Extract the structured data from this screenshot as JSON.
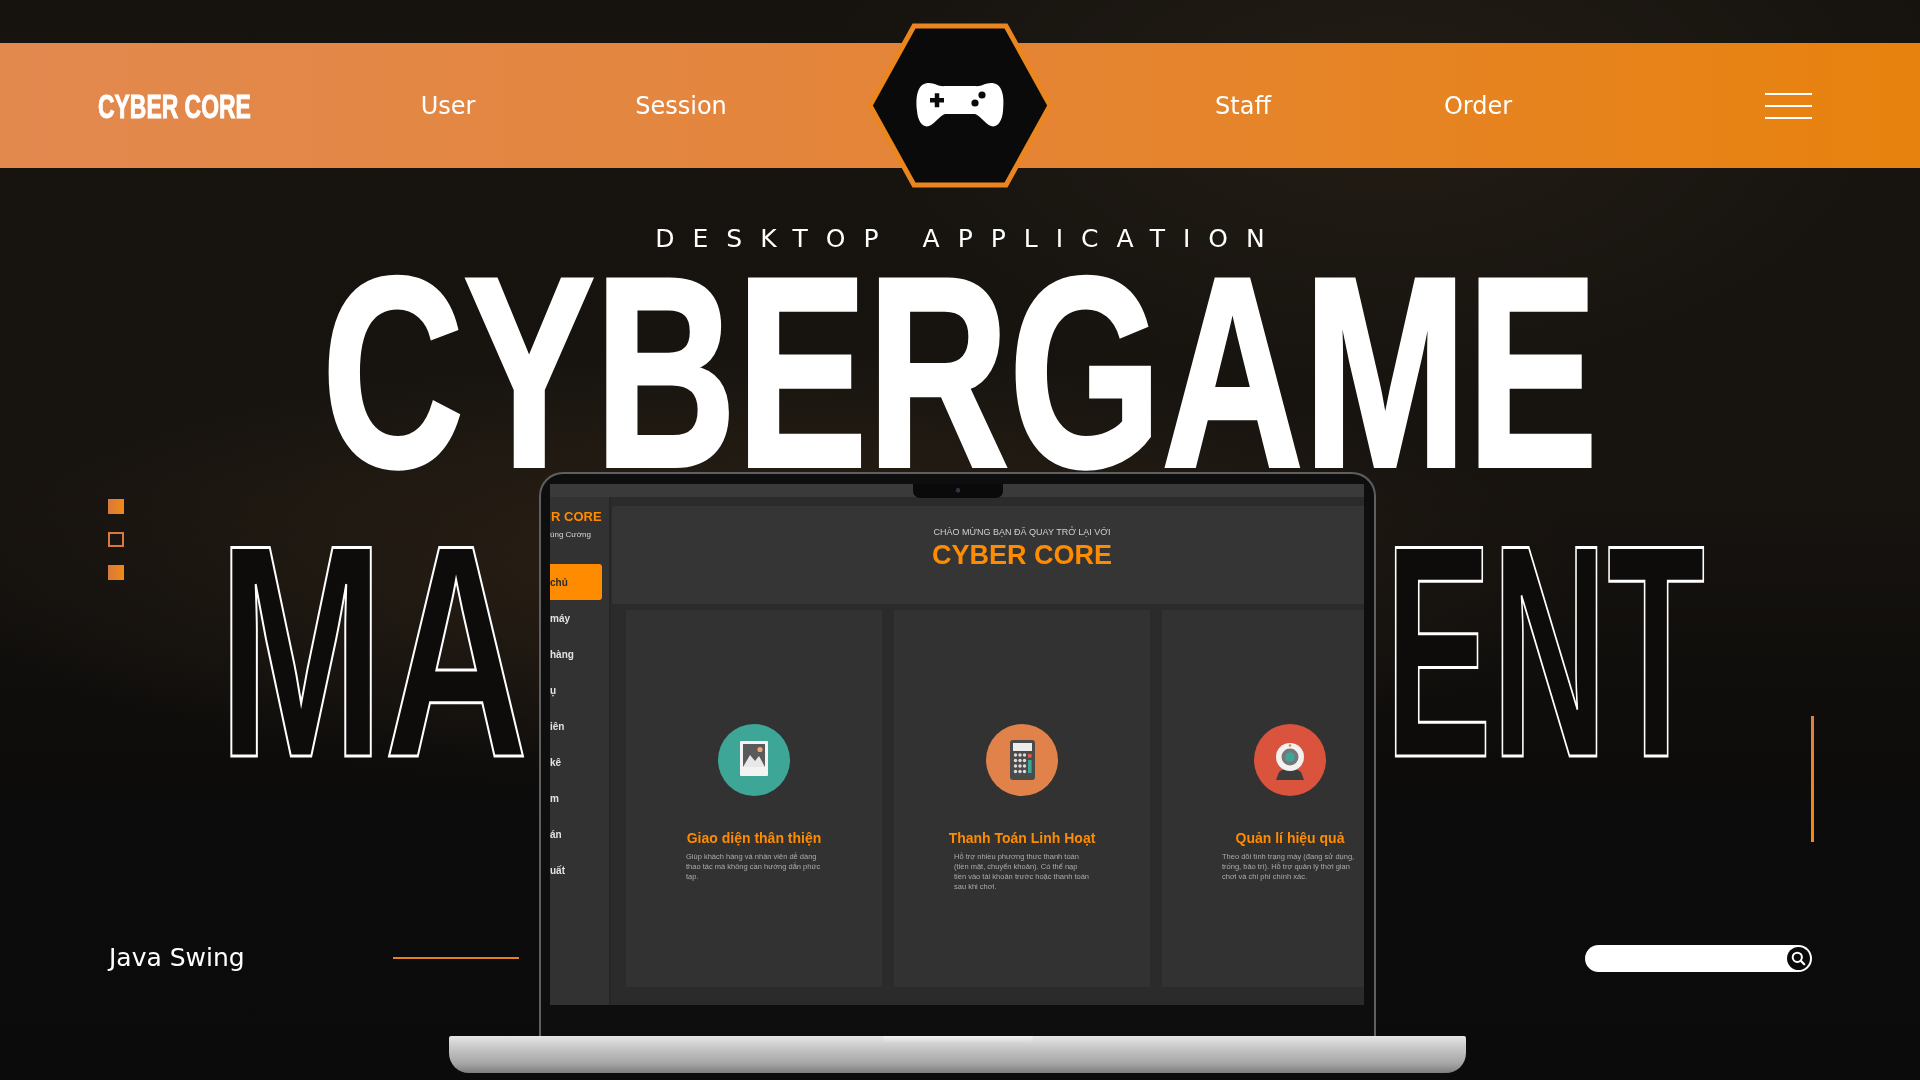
{
  "header": {
    "logo": "CYBER CORE",
    "nav": [
      {
        "label": "User"
      },
      {
        "label": "Session"
      },
      {
        "label": "Staff"
      },
      {
        "label": "Order"
      }
    ]
  },
  "hero": {
    "subtitle": "DESKTOP APPLICATION",
    "title": "CYBERGAME",
    "outline_left": "MA",
    "outline_right": "ENT"
  },
  "side_markers": [
    {
      "filled": true
    },
    {
      "filled": false
    },
    {
      "filled": true
    }
  ],
  "laptop_app": {
    "sidebar": {
      "brand": "R CORE",
      "user": "ùng Cường",
      "menu": [
        {
          "label": "chủ",
          "selected": true
        },
        {
          "label": "máy",
          "selected": false
        },
        {
          "label": "hàng",
          "selected": false
        },
        {
          "label": "ụ",
          "selected": false
        },
        {
          "label": "iên",
          "selected": false
        },
        {
          "label": "kê",
          "selected": false
        },
        {
          "label": "m",
          "selected": false
        },
        {
          "label": "án",
          "selected": false
        },
        {
          "label": "uất",
          "selected": false
        }
      ]
    },
    "welcome": "CHÀO MỪNG BẠN ĐÃ QUAY TRỞ LẠI VỚI",
    "app_name": "CYBER CORE",
    "features": [
      {
        "kind": "image",
        "title": "Giao diện thân thiện",
        "description": "Giúp khách hàng và nhân viên dễ dàng thao tác mà không cần hướng dẫn phức tạp."
      },
      {
        "kind": "calculator",
        "title": "Thanh Toán Linh Hoạt",
        "description": "Hỗ trợ nhiều phương thức thanh toán (tiền mặt, chuyển khoản). Có thể nạp tiền vào tài khoản trước hoặc thanh toán sau khi chơi."
      },
      {
        "kind": "webcam",
        "title": "Quản lí hiệu quả",
        "description": "Theo dõi tình trạng máy (đang sử dụng, trống, bảo trì). Hỗ trợ quản lý thời gian chơi và chi phí chính xác."
      }
    ]
  },
  "footer": {
    "caption": "Java Swing"
  }
}
